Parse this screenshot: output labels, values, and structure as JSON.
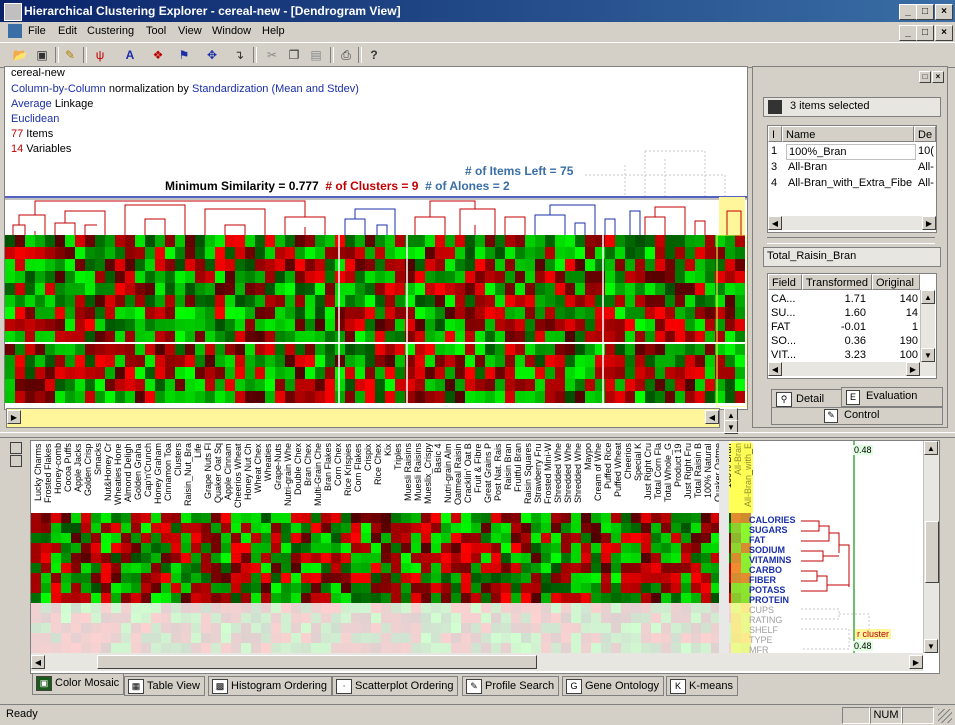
{
  "window": {
    "title": "Hierarchical Clustering Explorer - cereal-new - [Dendrogram View]",
    "buttons": {
      "minimize": "_",
      "maximize": "□",
      "close": "×"
    }
  },
  "menu": [
    "File",
    "Edit",
    "Custering",
    "Tool",
    "View",
    "Window",
    "Help"
  ],
  "toolbar": {
    "icons": [
      "open-icon",
      "save-icon",
      "edit-icon",
      "cluster-icon",
      "text-icon",
      "select-icon",
      "flag-icon",
      "move-icon",
      "pointer-icon",
      "cut-icon",
      "copy-icon",
      "paste-icon",
      "print-icon",
      "help-icon"
    ]
  },
  "info": {
    "dataset": "cereal-new",
    "normalization_prefix": "Column-by-Column",
    "normalization_mid": " normalization by ",
    "normalization_method": "Standardization (Mean and Stdev)",
    "linkage_type": "Average",
    "linkage_word": " Linkage",
    "distance": "Euclidean",
    "items_count": "77",
    "items_label": " Items",
    "variables_count": "14",
    "variables_label": " Variables"
  },
  "dendro_stats": {
    "items_left": "# of Items Left = 75",
    "min_similarity": "Minimum Similarity = 0.777",
    "clusters": "# of Clusters = 9",
    "alones": "# of Alones = 2"
  },
  "right_panel": {
    "selected_summary": "3 items selected",
    "columns": [
      "I",
      "Name",
      "De"
    ],
    "rows": [
      {
        "idx": "1",
        "name": "100%_Bran",
        "de": "10("
      },
      {
        "idx": "3",
        "name": "All-Bran",
        "de": "All-"
      },
      {
        "idx": "4",
        "name": "All-Bran_with_Extra_Fiber",
        "de": "All-"
      }
    ],
    "detail_title": "Total_Raisin_Bran",
    "detail_columns": [
      "Field",
      "Transformed",
      "Original"
    ],
    "detail_rows": [
      {
        "field": "CA...",
        "transformed": "1.71",
        "original": "140"
      },
      {
        "field": "SU...",
        "transformed": "1.60",
        "original": "14"
      },
      {
        "field": "FAT",
        "transformed": "-0.01",
        "original": "1"
      },
      {
        "field": "SO...",
        "transformed": "0.36",
        "original": "190"
      },
      {
        "field": "VIT...",
        "transformed": "3.23",
        "original": "100"
      }
    ],
    "tabs": [
      "Detail",
      "Evaluation",
      "Control"
    ]
  },
  "cereals": [
    "Lucky Charms",
    "Frosted Flakes",
    "Honey-comb",
    "Cocoa Puffs",
    "Apple Jacks",
    "Golden Crisp",
    "Smacks",
    "Nut&Honey Cr",
    "Wheaties Hone",
    "Almond Deligh",
    "Golden Graha",
    "Cap'n'Crunch",
    "Honey Graham",
    "Cinnamon Toa",
    "Clusters",
    "Raisin_Nut_Bra",
    "Life",
    "Grape Nuts Fl",
    "Quaker Oat Sq",
    "Apple Cinnam",
    "Cheerios Wheat",
    "Honey Nut Ch",
    "Wheat Chex",
    "Wheaties",
    "Grape-Nuts",
    "Nutri-grain Whe",
    "Double Chex",
    "Bran Chex",
    "Multi-Grain Che",
    "Bran Flakes",
    "Corn Chex",
    "Rice Krispies",
    "Corn Flakes",
    "Crispix",
    "Rice Chex",
    "Kix",
    "Triples",
    "Muesli Raisins",
    "Muesli Raisins",
    "Mueslix_Crispy",
    "Basic 4",
    "Nutri-grain Alm",
    "Oatmeal Raisin",
    "Cracklin' Oat B",
    "Fruit & Fibre",
    "Great Grains P",
    "Post Nat. Rais",
    "Raisin Bran",
    "Fruitful Bran",
    "Raisin Squares",
    "Strawberry Fru",
    "Frosted Mini-W",
    "Shredded Whe",
    "Shredded Whe",
    "Shredded Whe",
    "Maypo",
    "Cream of Whe",
    "Puffed Rice",
    "Puffed Wheat",
    "Cheerios",
    "Special K",
    "Just Right Cru",
    "Total Corn Fla",
    "Total Whole_G",
    "Product 19",
    "Just Right Fru",
    "Total Raisin B",
    "100% Natural",
    "Quaker Oatme",
    "100% Bran",
    "All-Bran",
    "All-Bran_with_E"
  ],
  "variables": {
    "bold": [
      "CALORIES",
      "SUGARS",
      "FAT",
      "SODIUM",
      "VITAMINS",
      "CARBO",
      "FIBER",
      "POTASS",
      "PROTEIN"
    ],
    "dim": [
      "CUPS",
      "RATING",
      "SHELF",
      "TYPE",
      "MFR"
    ]
  },
  "similarity": {
    "top": "0.48",
    "bottom": "0.48",
    "cluster_label": "r cluster"
  },
  "bottom_tabs": [
    "Color Mosaic",
    "Table View",
    "Histogram Ordering",
    "Scatterplot Ordering",
    "Profile Search",
    "Gene Ontology",
    "K-means"
  ],
  "status": {
    "text": "Ready",
    "num": "NUM"
  }
}
